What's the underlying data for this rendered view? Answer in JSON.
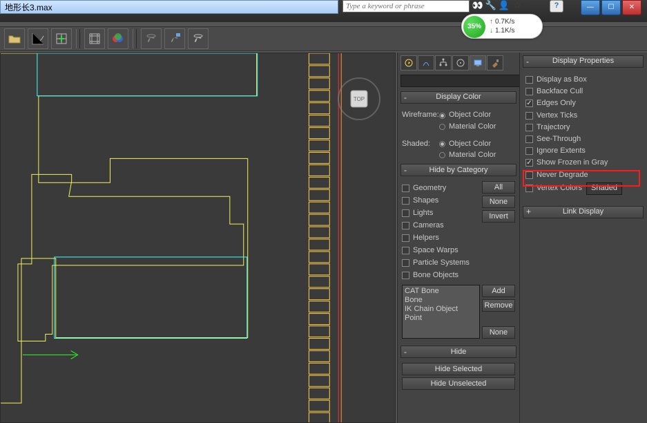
{
  "title": "地形长3.max",
  "search_placeholder": "Type a keyword or phrase",
  "speed": {
    "pct": "35%",
    "up": "0.7K/s",
    "dn": "1.1K/s"
  },
  "rollhdr": {
    "display_color": "Display Color",
    "hide_cat": "Hide by Category",
    "display_props": "Display Properties",
    "link_display": "Link Display",
    "hide": "Hide"
  },
  "display_color": {
    "wf": "Wireframe:",
    "sh": "Shaded:",
    "obj": "Object Color",
    "mat": "Material Color"
  },
  "hide_cat": {
    "items": [
      "Geometry",
      "Shapes",
      "Lights",
      "Cameras",
      "Helpers",
      "Space Warps",
      "Particle Systems",
      "Bone Objects"
    ],
    "btn_all": "All",
    "btn_none": "None",
    "btn_invert": "Invert",
    "extra": [
      "CAT Bone",
      "Bone",
      "IK Chain Object",
      "Point"
    ],
    "btn_add": "Add",
    "btn_remove": "Remove",
    "btn_none2": "None"
  },
  "hide": {
    "sel": "Hide Selected",
    "unsel": "Hide Unselected"
  },
  "display_props": {
    "items": [
      {
        "label": "Display as Box",
        "on": false
      },
      {
        "label": "Backface Cull",
        "on": false
      },
      {
        "label": "Edges Only",
        "on": true
      },
      {
        "label": "Vertex Ticks",
        "on": false
      },
      {
        "label": "Trajectory",
        "on": false
      },
      {
        "label": "See-Through",
        "on": false
      },
      {
        "label": "Ignore Extents",
        "on": false
      },
      {
        "label": "Show Frozen in Gray",
        "on": true
      },
      {
        "label": "Never Degrade",
        "on": false
      },
      {
        "label": "Vertex Colors",
        "on": false
      }
    ],
    "shaded": "Shaded"
  },
  "vcube": "TOP"
}
